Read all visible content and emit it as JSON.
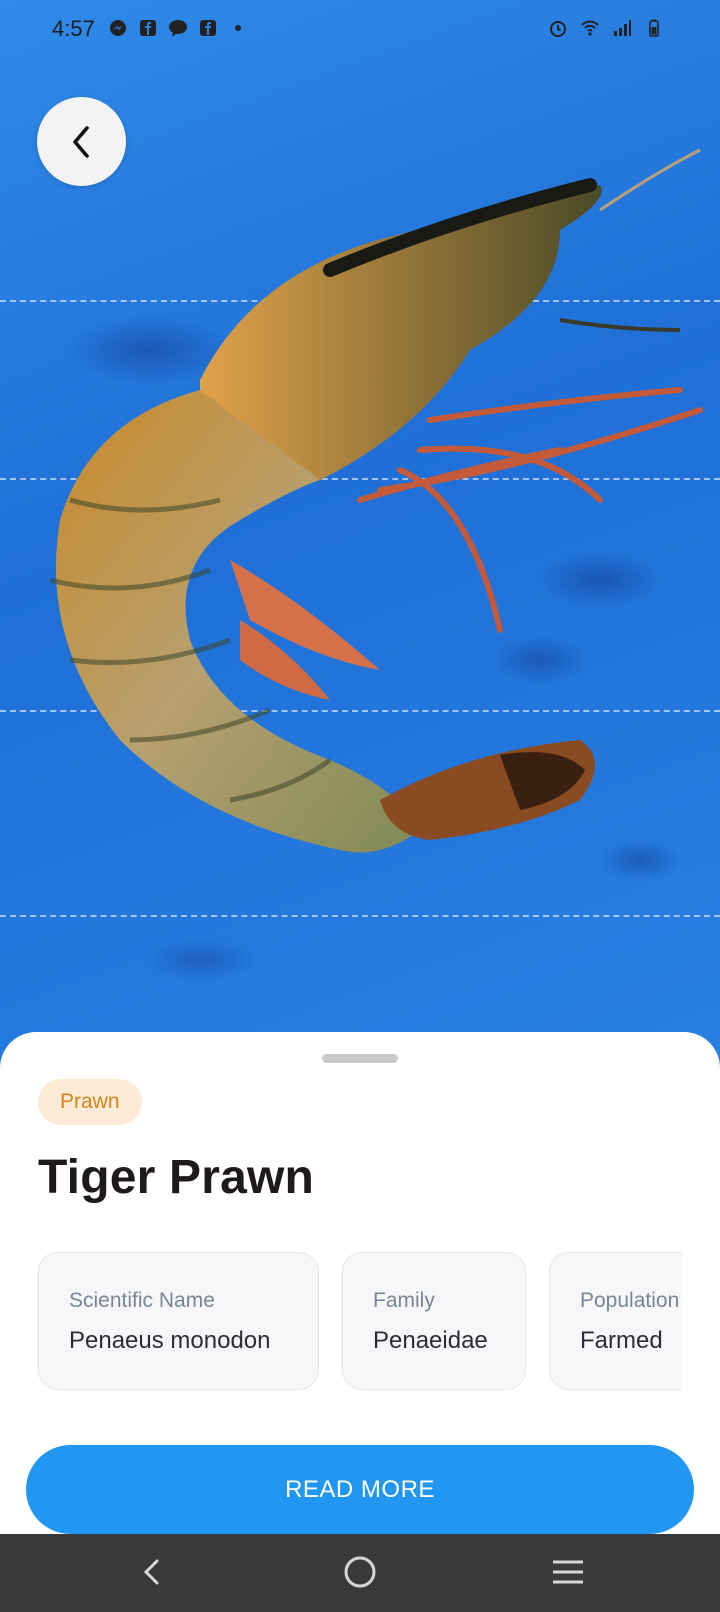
{
  "status_bar": {
    "time": "4:57",
    "left_icons": [
      "messenger-icon",
      "facebook-icon",
      "chat-bubble-icon",
      "facebook-icon",
      "dot-icon"
    ],
    "right_icons": [
      "alarm-icon",
      "wifi-icon",
      "signal-icon",
      "battery-icon"
    ]
  },
  "header": {
    "back_icon": "chevron-left-icon"
  },
  "detail": {
    "category_tag": "Prawn",
    "title": "Tiger Prawn",
    "info_cards": [
      {
        "label": "Scientific Name",
        "value": "Penaeus monodon"
      },
      {
        "label": "Family",
        "value": "Penaeidae"
      },
      {
        "label": "Population",
        "value": "Farmed"
      }
    ],
    "read_more_label": "READ MORE"
  },
  "colors": {
    "accent": "#2196f3",
    "tag_bg": "#fdebd6",
    "tag_text": "#d9821f",
    "title": "#1f1a1a",
    "navbar": "#3a3a3a"
  },
  "nav_bar": {
    "icons": [
      "back-nav-icon",
      "home-nav-icon",
      "recents-nav-icon"
    ]
  }
}
